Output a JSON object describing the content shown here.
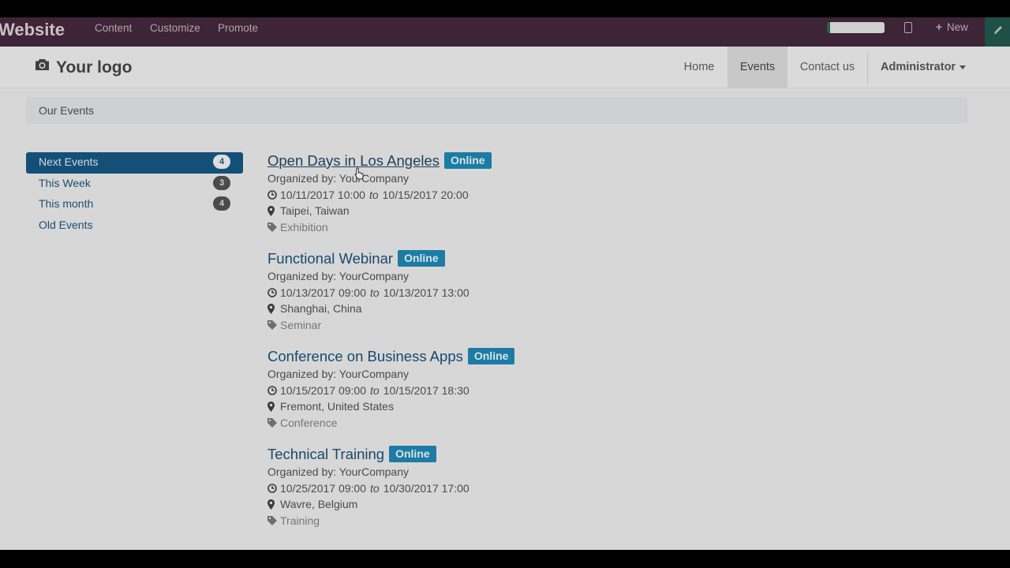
{
  "topbar": {
    "brand": "Website",
    "menu": [
      "Content",
      "Customize",
      "Promote"
    ],
    "new_label": "New"
  },
  "header": {
    "logo": "Your logo",
    "nav": [
      {
        "label": "Home",
        "active": false
      },
      {
        "label": "Events",
        "active": true
      },
      {
        "label": "Contact us",
        "active": false
      }
    ],
    "user": "Administrator"
  },
  "breadcrumb": "Our Events",
  "sidebar": {
    "items": [
      {
        "label": "Next Events",
        "count": "4",
        "active": true
      },
      {
        "label": "This Week",
        "count": "3",
        "active": false
      },
      {
        "label": "This month",
        "count": "4",
        "active": false
      },
      {
        "label": "Old Events",
        "count": "",
        "active": false
      }
    ]
  },
  "events": [
    {
      "title": "Open Days in Los Angeles",
      "badge": "Online",
      "organizer": "Organized by: YourCompany",
      "start": "10/11/2017 10:00",
      "to": "to",
      "end": "10/15/2017 20:00",
      "location": "Taipei, Taiwan",
      "tag": "Exhibition"
    },
    {
      "title": "Functional Webinar",
      "badge": "Online",
      "organizer": "Organized by: YourCompany",
      "start": "10/13/2017 09:00",
      "to": "to",
      "end": "10/13/2017 13:00",
      "location": "Shanghai, China",
      "tag": "Seminar"
    },
    {
      "title": "Conference on Business Apps",
      "badge": "Online",
      "organizer": "Organized by: YourCompany",
      "start": "10/15/2017 09:00",
      "to": "to",
      "end": "10/15/2017 18:30",
      "location": "Fremont, United States",
      "tag": "Conference"
    },
    {
      "title": "Technical Training",
      "badge": "Online",
      "organizer": "Organized by: YourCompany",
      "start": "10/25/2017 09:00",
      "to": "to",
      "end": "10/30/2017 17:00",
      "location": "Wavre, Belgium",
      "tag": "Training"
    }
  ],
  "colors": {
    "editor_bar": "#3d2436",
    "link": "#17496d",
    "active_nav": "#144f78",
    "badge": "#1c7ca3"
  }
}
